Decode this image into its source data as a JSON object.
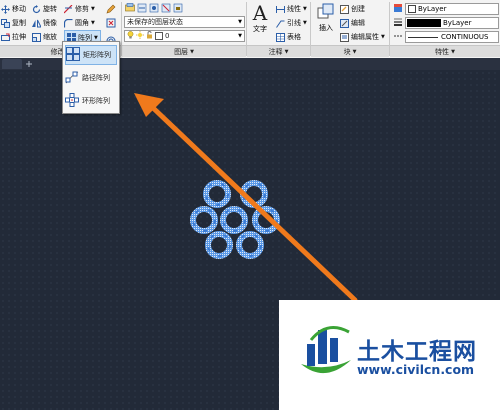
{
  "ribbon": {
    "modify": {
      "col1": [
        "移动",
        "复制",
        "拉伸"
      ],
      "col2": [
        "旋转",
        "镜像",
        "缩放"
      ],
      "col3": [
        "修剪",
        "圆角",
        "阵列"
      ],
      "panel_label": "修改"
    },
    "layers": {
      "layer_state": "未保存的图层状态",
      "current_layer": "0",
      "panel_label": "图层"
    },
    "annotation": {
      "text_button": "文字",
      "items": [
        "线性",
        "引线",
        "表格"
      ],
      "panel_label": "注释"
    },
    "block": {
      "insert_button": "插入",
      "items": [
        "创建",
        "编辑",
        "编辑属性"
      ],
      "panel_label": "块"
    },
    "properties": {
      "color": "ByLayer",
      "linetype": "ByLayer",
      "lineweight": "CONTINUOUS",
      "panel_label": "特性",
      "color_swatch": "#000000"
    }
  },
  "array_flyout": {
    "items": [
      "矩形阵列",
      "路径阵列",
      "环形阵列"
    ],
    "selected_index": 0
  },
  "watermark": {
    "title": "土木工程网",
    "url": "www.civilcn.com"
  },
  "colors": {
    "canvas": "#222a38",
    "ribbon": "#f3f3f3",
    "arrow": "#f07a1c",
    "ring": "#3a7bd5",
    "watermark_blue": "#1a4fa0",
    "watermark_green": "#3aa335"
  }
}
